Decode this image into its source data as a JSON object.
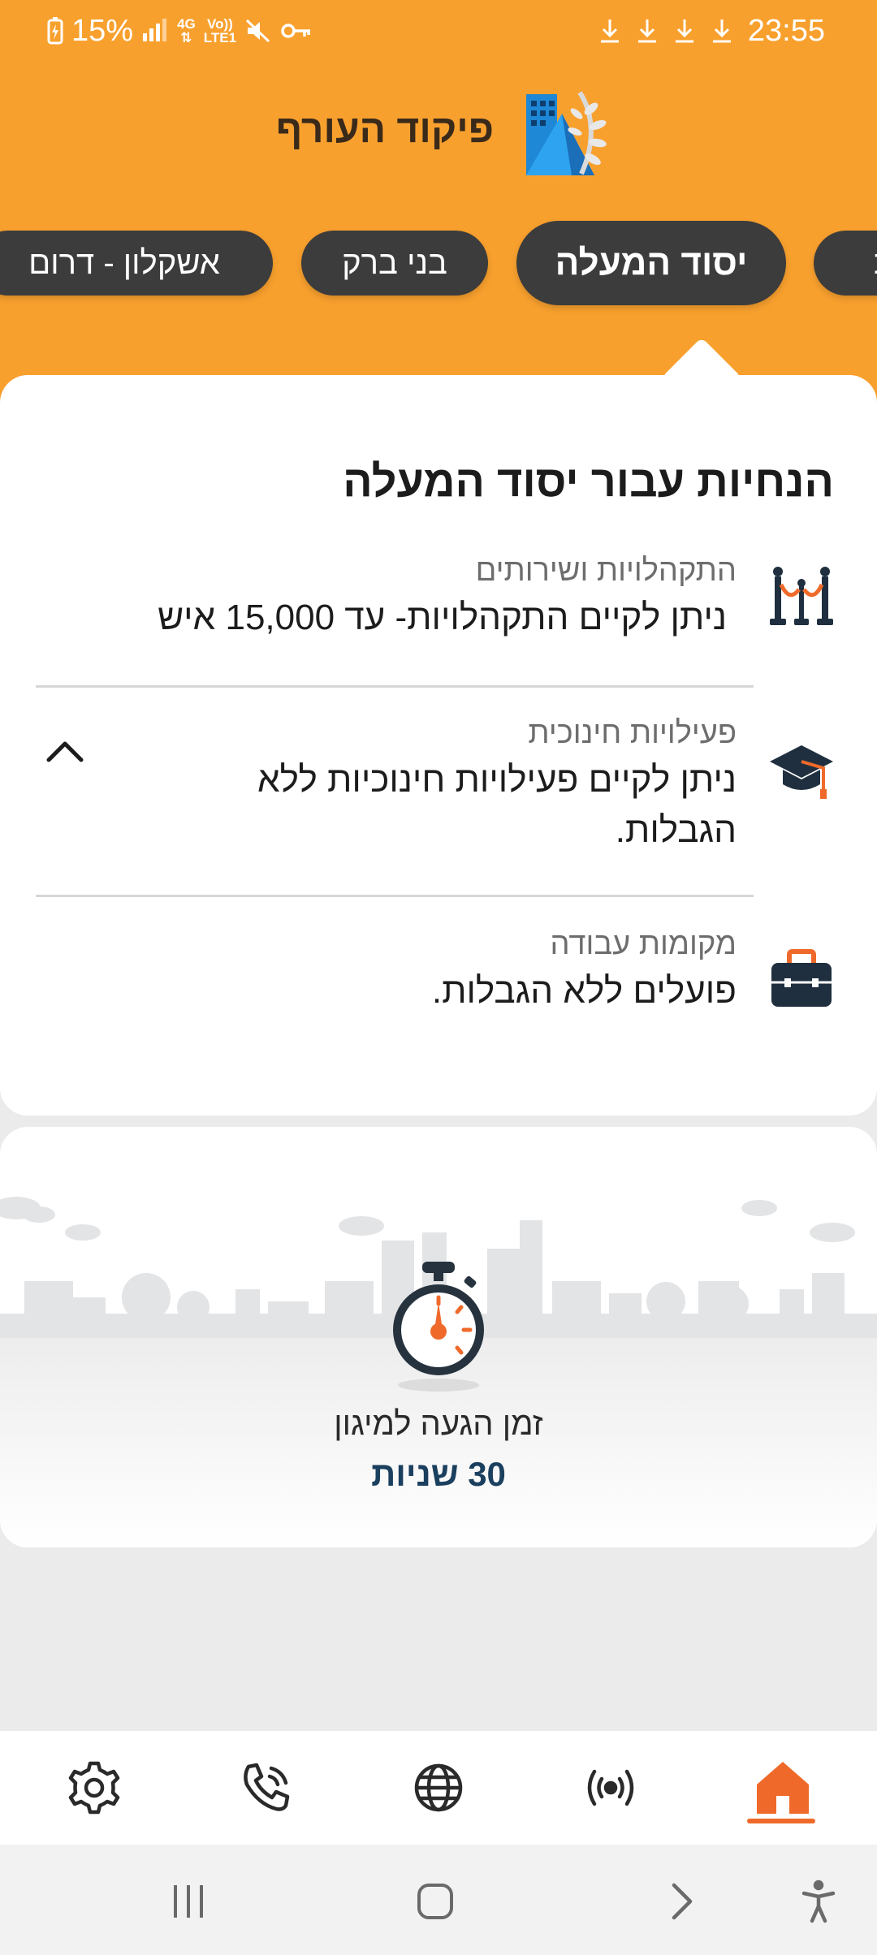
{
  "status_bar": {
    "battery_percent": "15%",
    "network_4g": "4G",
    "volte_line1": "Vo))",
    "volte_line2": "LTE1",
    "time": "23:55"
  },
  "header": {
    "title": "פיקוד העורף"
  },
  "tabs": [
    {
      "label": "אשקלון - דרום",
      "active": false
    },
    {
      "label": "בני ברק",
      "active": false
    },
    {
      "label": "יסוד המעלה",
      "active": true
    },
    {
      "label": "ת",
      "active": false
    }
  ],
  "guidance": {
    "title": "הנחיות עבור יסוד המעלה",
    "items": [
      {
        "icon": "stanchion-icon",
        "label": "התקהלויות ושירותים",
        "value": "ניתן לקיים התקהלויות- עד 15,000 איש"
      },
      {
        "icon": "graduation-cap-icon",
        "label": "פעילויות חינוכית",
        "value": "ניתן לקיים פעילויות חינוכיות ללא הגבלות."
      },
      {
        "icon": "briefcase-icon",
        "label": "מקומות עבודה",
        "value": "פועלים ללא הגבלות."
      }
    ]
  },
  "arrival": {
    "label": "זמן הגעה למיגון",
    "value": "30 שניות"
  },
  "bottom_nav": [
    {
      "icon": "gear-icon",
      "active": false
    },
    {
      "icon": "phone-icon",
      "active": false
    },
    {
      "icon": "globe-icon",
      "active": false
    },
    {
      "icon": "broadcast-icon",
      "active": false
    },
    {
      "icon": "home-icon",
      "active": true
    }
  ],
  "colors": {
    "header_orange": "#f8a02e",
    "accent_orange": "#ef6a2a",
    "tab_dark": "#3c3c3c",
    "time_value_blue": "#1b3f5e"
  }
}
